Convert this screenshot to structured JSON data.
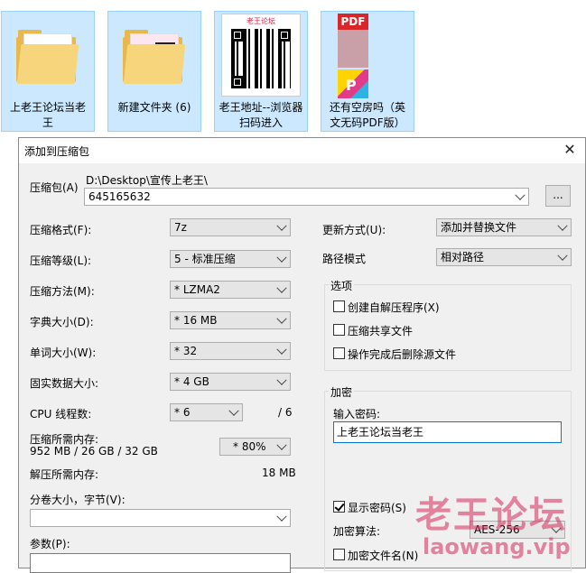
{
  "explorer": {
    "files": [
      {
        "name": "上老王论坛当老王",
        "icon": "folder-icon",
        "selected": true
      },
      {
        "name": "新建文件夹 (6)",
        "icon": "folder-icon",
        "selected": true
      },
      {
        "name": "老王地址--浏览器扫码进入",
        "icon": "qr-image-icon",
        "selected": true,
        "thumb_title": "老王论坛"
      },
      {
        "name": "还有空房吗（英文无码PDF版）",
        "icon": "pdf-icon",
        "selected": true,
        "thumb_badge": "PDF"
      }
    ]
  },
  "dialog": {
    "title": "添加到压缩包",
    "close": "✕",
    "archive_label": "压缩包(A)",
    "archive_path": "D:\\Desktop\\宣传上老王\\",
    "archive_name": "645165632",
    "browse_label": "...",
    "left": {
      "format_label": "压缩格式(F):",
      "format_value": "7z",
      "level_label": "压缩等级(L):",
      "level_value": "5 - 标准压缩",
      "method_label": "压缩方法(M):",
      "method_value": "* LZMA2",
      "dict_label": "字典大小(D):",
      "dict_value": "* 16 MB",
      "word_label": "单词大小(W):",
      "word_value": "* 32",
      "solid_label": "固实数据大小:",
      "solid_value": "* 4 GB",
      "cpu_label": "CPU 线程数:",
      "cpu_value": "* 6",
      "cpu_total": "/ 6",
      "mem_label": "压缩所需内存:",
      "mem_detail": "952 MB / 26 GB / 32 GB",
      "mem_value": "* 80%",
      "decomp_label": "解压所需内存:",
      "decomp_value": "18 MB",
      "split_label": "分卷大小，字节(V):",
      "split_value": "",
      "params_label": "参数(P):",
      "params_value": ""
    },
    "right": {
      "update_label": "更新方式(U):",
      "update_value": "添加并替换文件",
      "pathmode_label": "路径模式",
      "pathmode_value": "相对路径",
      "options_title": "选项",
      "opt_sfx": "创建自解压程序(X)",
      "opt_shared": "压缩共享文件",
      "opt_delete": "操作完成后删除源文件",
      "encryption_title": "加密",
      "password_label": "输入密码:",
      "password_value": "上老王论坛当老王",
      "show_password": "显示密码(S)",
      "show_password_checked": true,
      "enc_method_label": "加密算法:",
      "enc_method_value": "AES-256",
      "encrypt_names": "加密文件名(N)"
    }
  },
  "watermark": {
    "cn": "老王论坛",
    "en": "laowang.vip"
  }
}
